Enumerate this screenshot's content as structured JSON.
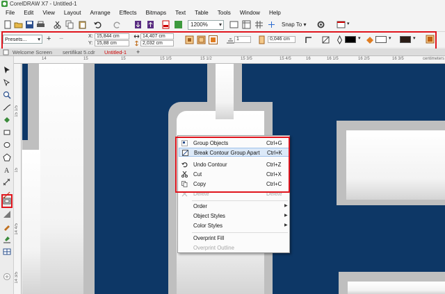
{
  "window": {
    "title": "CorelDRAW X7 - Untitled-1"
  },
  "menu": [
    "File",
    "Edit",
    "View",
    "Layout",
    "Arrange",
    "Effects",
    "Bitmaps",
    "Text",
    "Table",
    "Tools",
    "Window",
    "Help"
  ],
  "standard_toolbar": {
    "zoom_value": "1200%",
    "snap_label": "Snap To"
  },
  "property_bar": {
    "presets_label": "Presets...",
    "x_label": "X:",
    "x_value": "15,844 cm",
    "y_label": "Y:",
    "y_value": "15,88 cm",
    "width_value": "14,407 cm",
    "height_value": "2,032 cm",
    "count_value": "1",
    "outline_width_value": "0,046 cm",
    "outline_color": "#000000",
    "fill_color": "#ffffff",
    "extra_color": "#2a1d16"
  },
  "tabs": [
    {
      "label": "Welcome Screen"
    },
    {
      "label": "sertifikat 5.cdr"
    },
    {
      "label": "Untitled-1",
      "active": true
    }
  ],
  "ruler": {
    "horizontal_ticks": [
      "14",
      "15",
      "15",
      "15 1/5",
      "15 1/2",
      "15 3/5",
      "15 4/5",
      "16",
      "16 1/5",
      "16 2/5",
      "16 3/5",
      "centimeters"
    ],
    "vertical_ticks": [
      "15 1/5",
      "15",
      "14 4/5",
      "14 3/5"
    ]
  },
  "context_menu": {
    "items": [
      {
        "label": "Group Objects",
        "shortcut": "Ctrl+G",
        "icon": "group-objects-icon"
      },
      {
        "label": "Break Contour Group Apart",
        "shortcut": "Ctrl+K",
        "icon": "break-apart-icon",
        "highlighted": true
      },
      {
        "label": "Undo Contour",
        "shortcut": "Ctrl+Z",
        "icon": "undo-icon"
      },
      {
        "label": "Cut",
        "shortcut": "Ctrl+X",
        "icon": "scissors-icon"
      },
      {
        "label": "Copy",
        "shortcut": "Ctrl+C",
        "icon": "copy-icon"
      },
      {
        "label": "Delete",
        "shortcut": "Delete",
        "icon": "delete-icon"
      },
      {
        "label": "Order",
        "submenu": true
      },
      {
        "label": "Object Styles",
        "submenu": true
      },
      {
        "label": "Color Styles",
        "submenu": true
      },
      {
        "label": "Overprint Fill"
      },
      {
        "label": "Overprint Outline",
        "disabled": true
      }
    ]
  },
  "colors": {
    "highlight_frame": "#e0141c",
    "canvas_background": "#0d3766"
  }
}
